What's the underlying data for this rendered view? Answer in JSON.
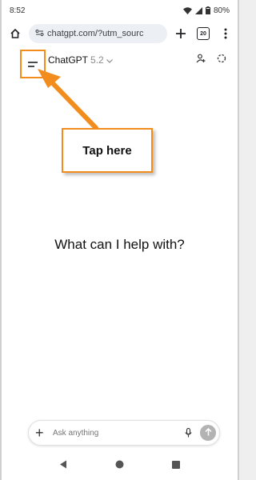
{
  "status_bar": {
    "time": "8:52",
    "battery_percent": "80%",
    "icons": [
      "wifi-icon",
      "signal-icon",
      "battery-icon"
    ]
  },
  "browser": {
    "url": "chatgpt.com/?utm_sourc",
    "tab_count": "20",
    "icons": [
      "home-icon",
      "site-settings-icon",
      "new-tab-icon",
      "tab-switcher-icon",
      "more-icon"
    ]
  },
  "app_header": {
    "model_name": "ChatGPT",
    "model_version": "5.2",
    "icons": [
      "menu-icon",
      "chevron-down-icon",
      "add-person-icon",
      "temporary-chat-icon"
    ]
  },
  "annotation": {
    "text": "Tap here",
    "color": "#f28c1c"
  },
  "main": {
    "greeting": "What can I help with?"
  },
  "composer": {
    "placeholder": "Ask anything",
    "icons": [
      "plus-icon",
      "mic-icon",
      "send-icon"
    ]
  },
  "nav_bar": {
    "icons": [
      "back-icon",
      "home-icon",
      "recents-icon"
    ]
  }
}
